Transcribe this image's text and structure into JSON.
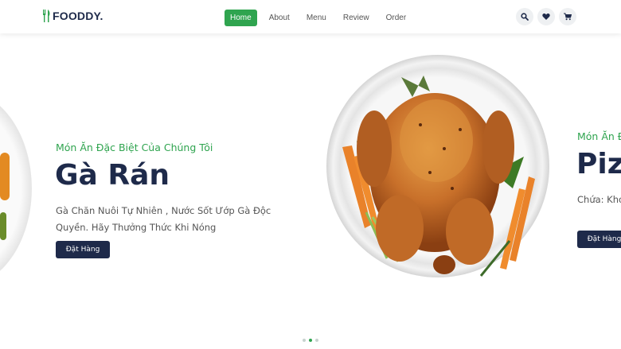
{
  "brand": {
    "name": "FOODDY.",
    "color": "#2fa44f",
    "dark": "#1e2a4a"
  },
  "nav": {
    "items": [
      {
        "label": "Home",
        "active": true
      },
      {
        "label": "About",
        "active": false
      },
      {
        "label": "Menu",
        "active": false
      },
      {
        "label": "Review",
        "active": false
      },
      {
        "label": "Order",
        "active": false
      }
    ]
  },
  "header_icons": [
    "search-icon",
    "heart-icon",
    "cart-icon"
  ],
  "slides": [
    {
      "subtitle": "Món Ăn Đặc Biệt Của Chúng Tôi",
      "title": "Gà Rán",
      "description": "Gà Chăn Nuôi Tự Nhiên , Nước Sốt Ướp Gà Độc Quyền. Hãy Thưởng Thức Khi Nóng",
      "button": "Đặt Hàng"
    },
    {
      "subtitle": "Món Ăn Đ",
      "title": "Pizz",
      "description": "Chứa: Khoa Tây, Sốt Cà",
      "button": "Đặt Hàng"
    }
  ],
  "pagination": {
    "count": 3,
    "active_index": 1
  }
}
